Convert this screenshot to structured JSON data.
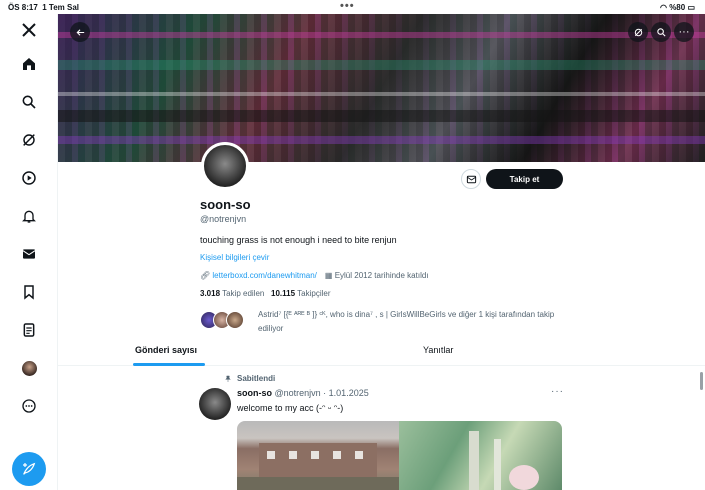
{
  "status_bar": {
    "time": "ÖS 8:17",
    "date": "1 Tem Sal",
    "battery": "%80"
  },
  "sidebar": {
    "items": [
      {
        "name": "x-logo",
        "label": "𝕏"
      },
      {
        "name": "home-icon"
      },
      {
        "name": "search-icon"
      },
      {
        "name": "grok-icon"
      },
      {
        "name": "video-icon"
      },
      {
        "name": "notifications-icon"
      },
      {
        "name": "messages-icon"
      },
      {
        "name": "bookmarks-icon"
      },
      {
        "name": "lists-icon"
      },
      {
        "name": "profile-avatar-icon"
      },
      {
        "name": "more-icon"
      }
    ],
    "compose_icon": "compose-icon"
  },
  "profile": {
    "name": "soon-so",
    "handle": "@notrenjvn",
    "bio": "touching grass is not enough i need to bite renjun",
    "translate_label": "Kişisel bilgileri çevir",
    "link": "letterboxd.com/danewhitman/",
    "joined": "Eylül 2012 tarihinde katıldı",
    "following_count": "3.018",
    "following_label": "Takip edilen",
    "followers_count": "10.115",
    "followers_label": "Takipçiler",
    "followed_by_text": "Astrid⁷ [{ᴱ ᴬᴿᴱ ᴮ ]} ᶜᴷ, who is dina⁷ , s | GirlsWillBeGirls ve diğer 1 kişi tarafından takip ediliyor",
    "follow_button": "Takip et"
  },
  "tabs": [
    {
      "label": "Gönderi sayısı",
      "active": true
    },
    {
      "label": "Yanıtlar",
      "active": false
    }
  ],
  "post": {
    "pinned_label": "Sabitlendi",
    "author": "soon-so",
    "handle_date": "@notrenjvn · 1.01.2025",
    "text": "welcome to my acc  (-ᵔ ᵕ ᵔ-)",
    "more": "···"
  },
  "colors": {
    "accent": "#1d9bf0",
    "text": "#0f1419",
    "muted": "#536471"
  }
}
